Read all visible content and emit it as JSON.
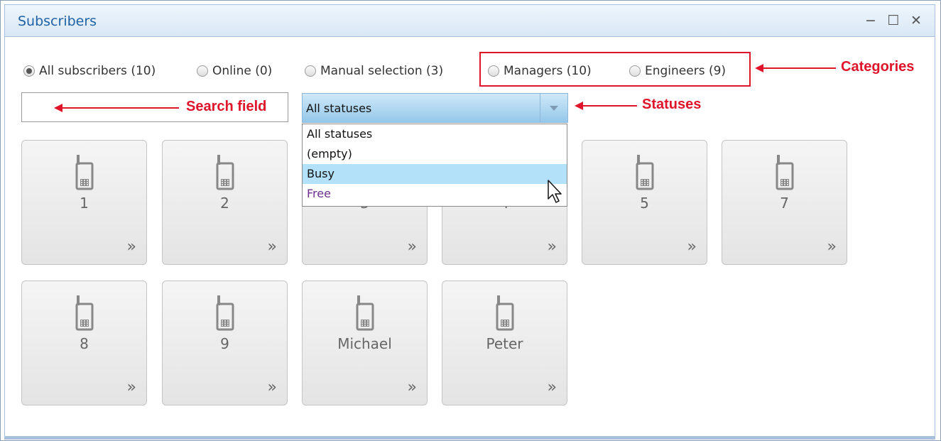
{
  "window": {
    "title": "Subscribers",
    "controls": {
      "minimize": "−",
      "maximize": "☐",
      "close": "✕"
    }
  },
  "filters": [
    {
      "label": "All subscribers (10)",
      "checked": true
    },
    {
      "label": "Online (0)",
      "checked": false
    },
    {
      "label": "Manual selection (3)",
      "checked": false
    },
    {
      "label": "Managers (10)",
      "checked": false
    },
    {
      "label": "Engineers (9)",
      "checked": false
    }
  ],
  "annotations": {
    "categories": "Categories",
    "search": "Search field",
    "statuses": "Statuses",
    "color": "#e0142a"
  },
  "search": {
    "value": "",
    "placeholder": ""
  },
  "status_select": {
    "selected": "All statuses",
    "options": [
      "All statuses",
      "(empty)",
      "Busy",
      "Free"
    ],
    "highlighted": "Busy"
  },
  "tiles": [
    {
      "label": "1"
    },
    {
      "label": "2"
    },
    {
      "label": "3"
    },
    {
      "label": "4"
    },
    {
      "label": "5"
    },
    {
      "label": "7"
    },
    {
      "label": "8"
    },
    {
      "label": "9"
    },
    {
      "label": "Michael"
    },
    {
      "label": "Peter"
    }
  ],
  "tile_arrow": "»",
  "icons": {
    "tile": "mobile-phone-icon",
    "expand": "double-chevron-right-icon",
    "pointer": "mouse-pointer-icon"
  },
  "colors": {
    "title": "#1e62a6",
    "highlight": "#b3e1f9",
    "combo": "#95c8ea"
  }
}
